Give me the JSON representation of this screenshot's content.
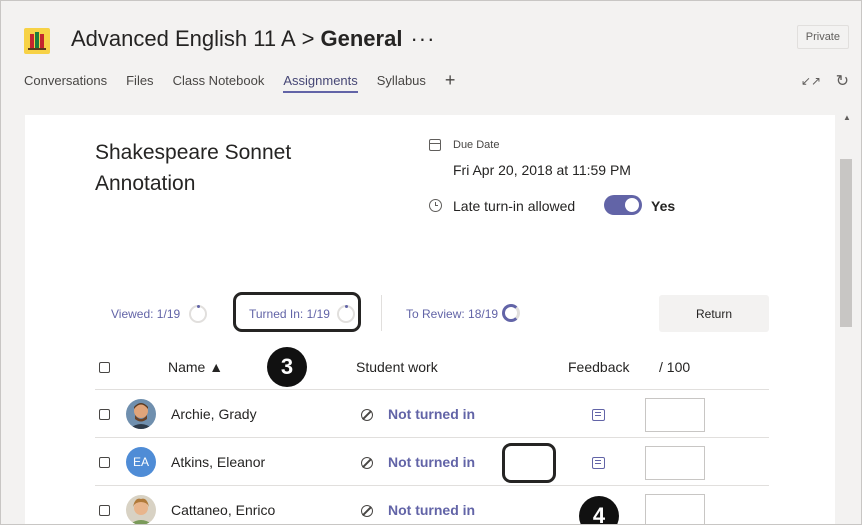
{
  "header": {
    "team": "Advanced English 11 A",
    "separator": ">",
    "channel": "General",
    "more": "···",
    "private_label": "Private"
  },
  "tabs": [
    {
      "label": "Conversations"
    },
    {
      "label": "Files"
    },
    {
      "label": "Class Notebook"
    },
    {
      "label": "Assignments",
      "active": true
    },
    {
      "label": "Syllabus"
    }
  ],
  "tab_add": "+",
  "icons": {
    "expand": "expand-icon",
    "refresh": "refresh-icon"
  },
  "assignment": {
    "title": "Shakespeare Sonnet Annotation",
    "due_label": "Due Date",
    "due_value": "Fri Apr 20, 2018 at 11:59 PM",
    "late_label": "Late turn-in allowed",
    "late_value": "Yes"
  },
  "stats": {
    "viewed": "Viewed: 1/19",
    "turned_in": "Turned In: 1/19",
    "to_review": "To Review: 18/19",
    "return_label": "Return"
  },
  "table": {
    "headers": {
      "name": "Name ▲",
      "work": "Student work",
      "feedback": "Feedback",
      "grade": "/ 100"
    },
    "rows": [
      {
        "name": "Archie, Grady",
        "status": "Not turned in",
        "avatar": "photo"
      },
      {
        "name": "Atkins, Eleanor",
        "status": "Not turned in",
        "avatar": "initials",
        "initials": "EA"
      },
      {
        "name": "Cattaneo, Enrico",
        "status": "Not turned in",
        "avatar": "photo"
      }
    ]
  },
  "callouts": {
    "badge3": "3",
    "badge4": "4"
  },
  "colors": {
    "accent": "#6264a7",
    "team_icon_bg": "#f7d246",
    "initials_avatar": "#4f8cd6"
  }
}
